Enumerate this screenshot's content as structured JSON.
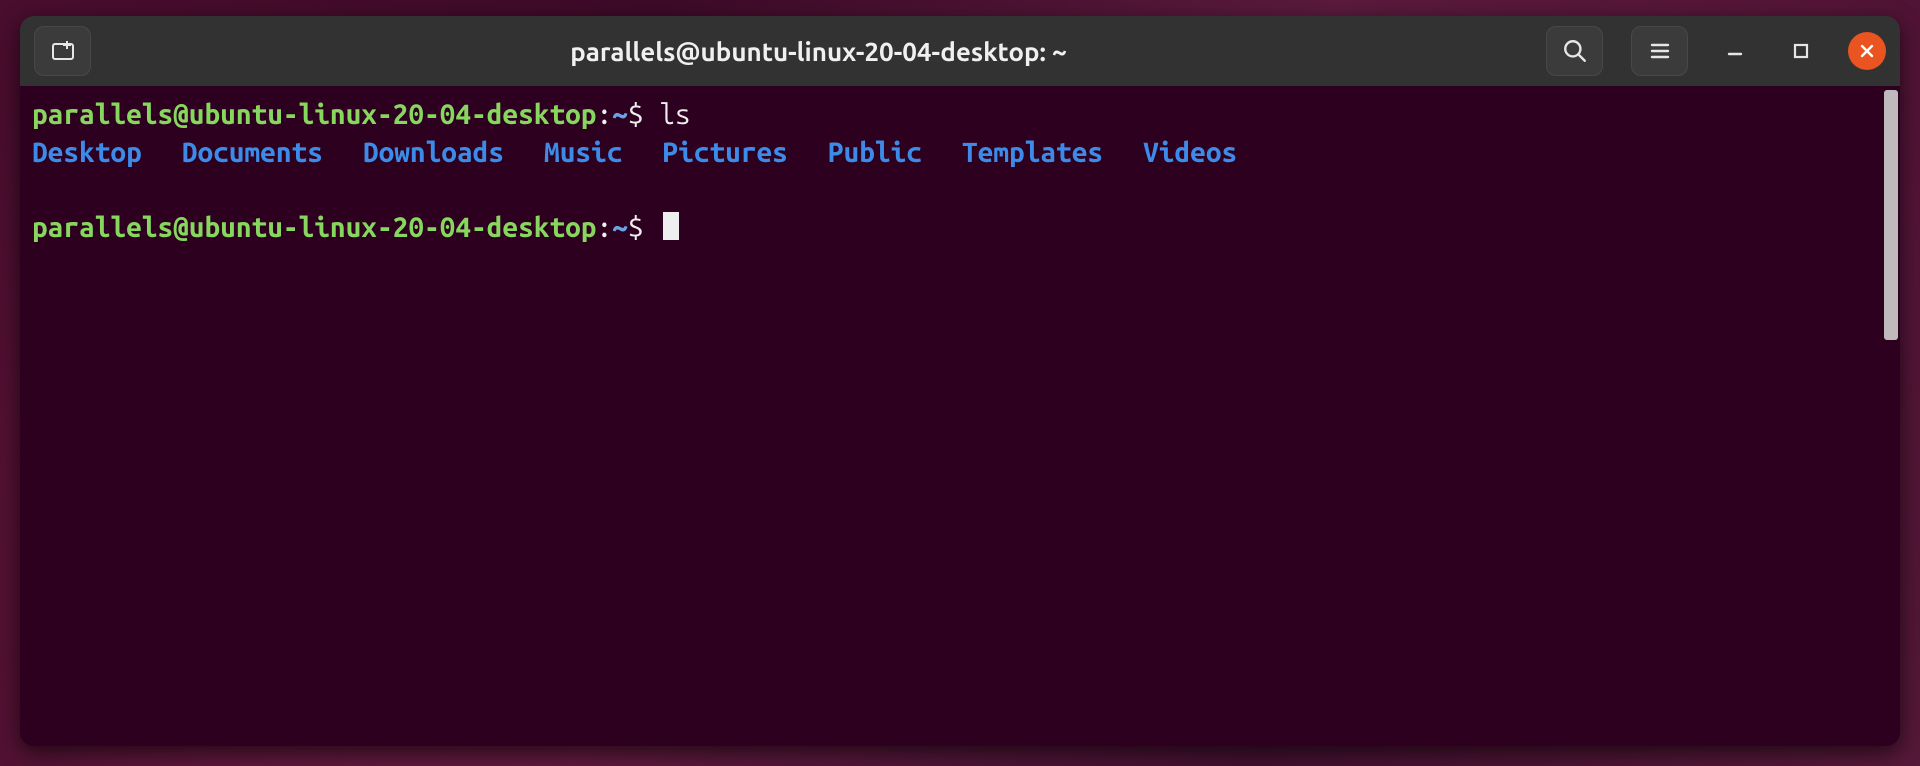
{
  "window": {
    "title": "parallels@ubuntu-linux-20-04-desktop: ~"
  },
  "prompt1": {
    "user_host": "parallels@ubuntu-linux-20-04-desktop",
    "sep1": ":",
    "path": "~",
    "dollar": "$",
    "command": "ls"
  },
  "ls": {
    "items": [
      "Desktop",
      "Documents",
      "Downloads",
      "Music",
      "Pictures",
      "Public",
      "Templates",
      "Videos"
    ]
  },
  "prompt2": {
    "user_host": "parallels@ubuntu-linux-20-04-desktop",
    "sep1": ":",
    "path": "~",
    "dollar": "$"
  },
  "icons": {
    "new_tab": "new-tab-icon",
    "search": "search-icon",
    "menu": "hamburger-icon",
    "minimize": "minimize-icon",
    "maximize": "maximize-icon",
    "close": "close-icon"
  }
}
